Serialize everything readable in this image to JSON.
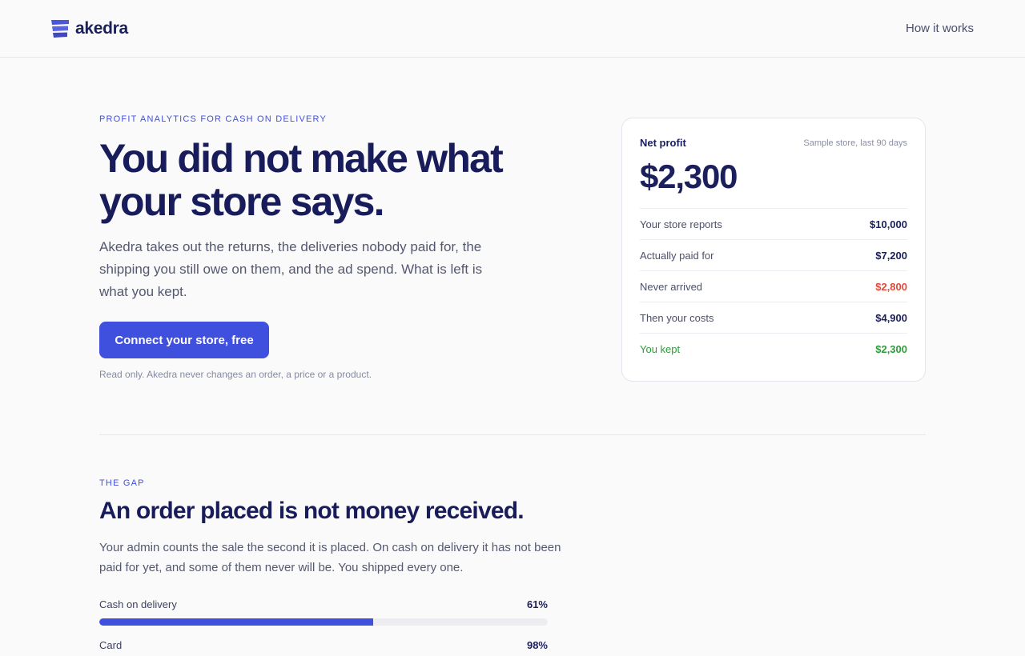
{
  "header": {
    "brand": "akedra",
    "nav_link": "How it works"
  },
  "colors": {
    "accent": "#3f4fde",
    "heading": "#181c5a",
    "negative": "#e2483a",
    "positive": "#2f9c3a"
  },
  "hero": {
    "eyebrow": "PROFIT ANALYTICS FOR CASH ON DELIVERY",
    "title_line1": "You did not make what",
    "title_line2": "your store says.",
    "lead": "Akedra takes out the returns, the deliveries nobody paid for, the shipping you still owe on them, and the ad spend. What is left is what you kept.",
    "cta": "Connect your store, free",
    "fine_print": "Read only. Akedra never changes an order, a price or a product."
  },
  "card": {
    "label": "Net profit",
    "meta": "Sample store, last 90 days",
    "value": "$2,300",
    "rows": [
      {
        "label": "Your store reports",
        "value": "$10,000"
      },
      {
        "label": "Actually paid for",
        "value": "$7,200"
      },
      {
        "label": "Never arrived",
        "value": "$2,800"
      },
      {
        "label": "Then your costs",
        "value": "$4,900"
      },
      {
        "label": "You kept",
        "value": "$2,300"
      }
    ]
  },
  "gap": {
    "eyebrow": "THE GAP",
    "title": "An order placed is not money received.",
    "lead": "Your admin counts the sale the second it is placed. On cash on delivery it has not been paid for yet, and some of them never will be. You shipped every one.",
    "bars": [
      {
        "label": "Cash on delivery",
        "pct_text": "61%",
        "pct": 61
      },
      {
        "label": "Card",
        "pct_text": "98%",
        "pct": 98
      }
    ]
  }
}
